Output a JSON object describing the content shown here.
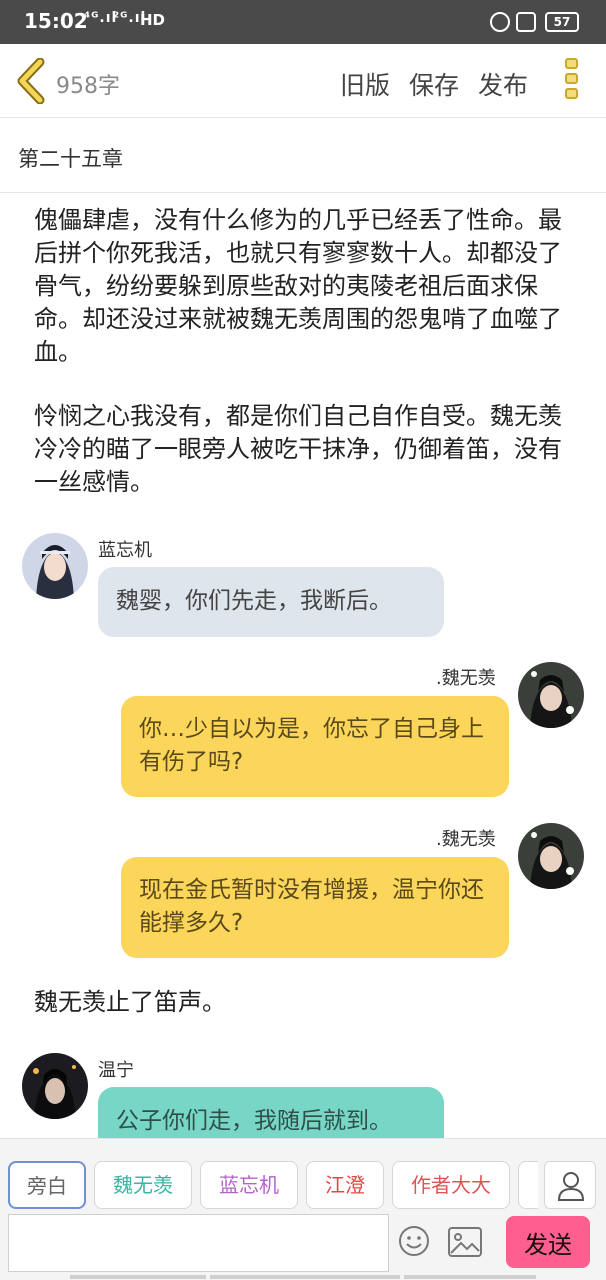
{
  "status": {
    "time": "15:02",
    "sig1": "⁴ᴳ.ıl",
    "sig2": "²ᴳ.ıl",
    "hd": "HD",
    "battery": "57"
  },
  "header": {
    "word_count": "958字",
    "old_label": "旧版",
    "save_label": "保存",
    "publish_label": "发布"
  },
  "chapter_title": "第二十五章",
  "content": {
    "paragraph1": "傀儡肆虐，没有什么修为的几乎已经丢了性命。最后拼个你死我活，也就只有寥寥数十人。却都没了骨气，纷纷要躲到原些敌对的夷陵老祖后面求保命。却还没过来就被魏无羡周围的怨鬼啃了血噬了血。",
    "paragraph2": "怜悯之心我没有，都是你们自己自作自受。魏无羡冷冷的瞄了一眼旁人被吃干抹净，仍御着笛，没有一丝感情。",
    "msg1": {
      "name": "蓝忘机",
      "text": "魏婴，你们先走，我断后。"
    },
    "msg2": {
      "name": ".魏无羡",
      "text": "你…少自以为是，你忘了自己身上有伤了吗?"
    },
    "msg3": {
      "name": ".魏无羡",
      "text": "现在金氏暂时没有增援，温宁你还能撑多久?"
    },
    "paragraph3": "魏无羡止了笛声。",
    "msg4": {
      "name": "温宁",
      "text": "公子你们走，我随后就到。"
    }
  },
  "roles": [
    "旁白",
    "魏无羡",
    "蓝忘机",
    "江澄",
    "作者大大"
  ],
  "input": {
    "placeholder": ""
  },
  "send_label": "发送",
  "colors": {
    "accent_send": "#ff5f8e",
    "bubble_blue": "#dfe5ec",
    "bubble_yellow": "#fcd55b",
    "bubble_teal": "#78d6c6"
  }
}
